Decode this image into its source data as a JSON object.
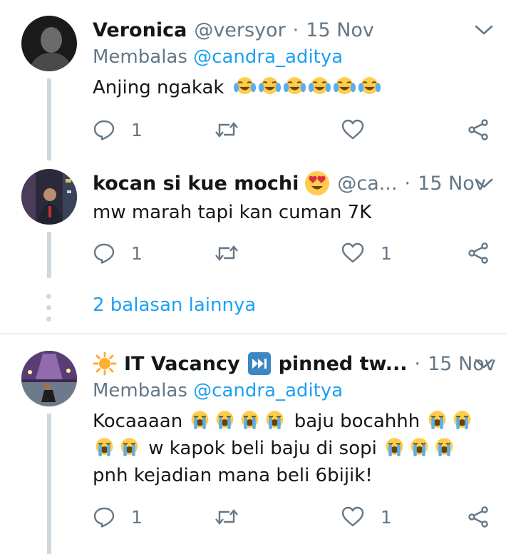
{
  "tweets": [
    {
      "name": "Veronica",
      "handle": "@versyor",
      "dot": "·",
      "date": "15 Nov",
      "reply_prefix": "Membalas",
      "reply_mention": "@candra_aditya",
      "text": "Anjing ngakak",
      "emoji": "face-with-tears-of-joy",
      "reply_count": "1",
      "retweet_count": "",
      "like_count": ""
    },
    {
      "name": "kocan si kue mochi",
      "handle": "@ca...",
      "dot": "·",
      "date": "15 Nov",
      "text": "mw marah tapi kan cuman 7K",
      "name_emoji": "heart-eyes",
      "reply_count": "1",
      "retweet_count": "",
      "like_count": "1"
    },
    {
      "name": "IT Vacancy",
      "name_suffix": "pinned tw...",
      "dot": "·",
      "date": "15 Nov",
      "reply_prefix": "Membalas",
      "reply_mention": "@candra_aditya",
      "text_line1_a": "Kocaaaan",
      "text_line1_b": "baju bocahhh",
      "text_line2": "w kapok beli baju di sopi",
      "text_line3": "pnh kejadian mana beli 6bijik!",
      "emoji": "loudly-crying-face",
      "reply_count": "1",
      "retweet_count": "",
      "like_count": "1"
    }
  ],
  "more_replies": "2 balasan lainnya",
  "colors": {
    "link": "#1da1f2",
    "secondary": "#657786",
    "thread_line": "#cfd9de",
    "divider": "#e6ecf0"
  }
}
